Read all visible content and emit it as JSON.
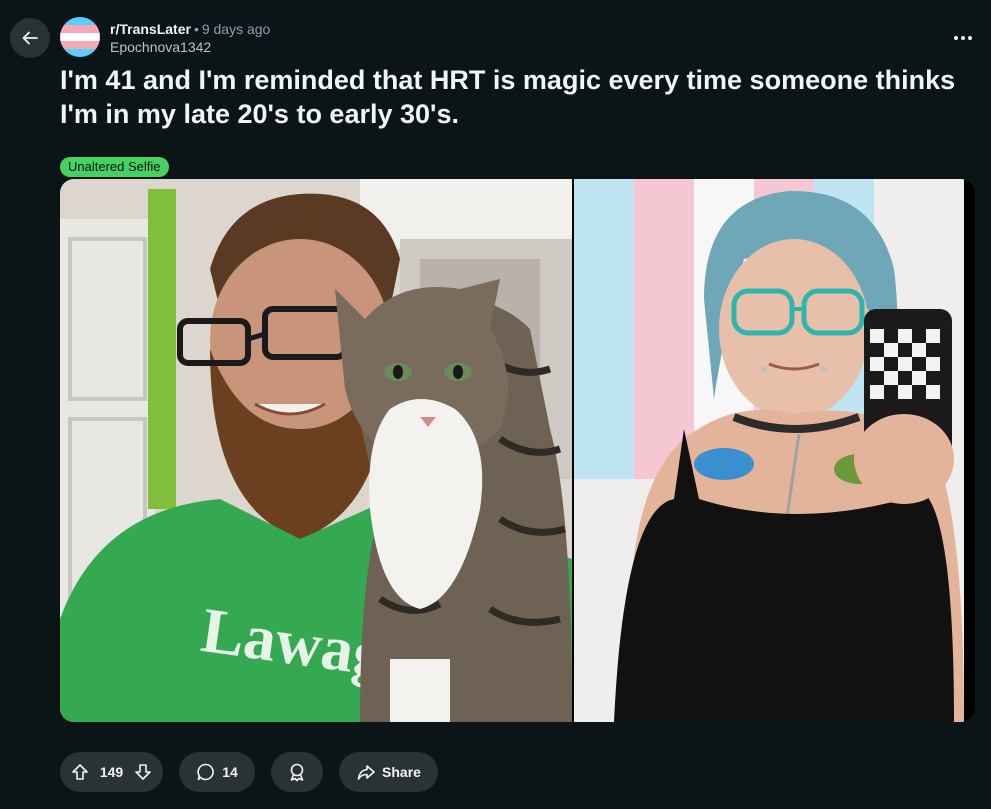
{
  "post": {
    "subreddit": "r/TransLater",
    "separator": "•",
    "time_ago": "9 days ago",
    "author": "Epochnova1342",
    "title": "I'm 41 and I'm reminded that HRT is magic every time someone thinks I'm in my late 20's to early 30's.",
    "flair": "Unaltered Selfie",
    "flair_color": "#46d160",
    "shirt_text": "Lawagé"
  },
  "actions": {
    "upvote_icon": "arrow-up-icon",
    "score": "149",
    "downvote_icon": "arrow-down-icon",
    "comment_icon": "speech-bubble-icon",
    "comments": "14",
    "award_icon": "award-icon",
    "share_icon": "share-arrow-icon",
    "share_label": "Share"
  },
  "icons": {
    "back": "arrow-left-icon",
    "more": "ellipsis-icon",
    "subreddit_avatar": "trans-flag-avatar"
  },
  "colors": {
    "background": "#0b1416",
    "pill": "#2a3236",
    "text": "#f2f4f5",
    "muted": "#8ba2ad",
    "trans_blue": "#5bcefa",
    "trans_pink": "#f5a9b8"
  }
}
